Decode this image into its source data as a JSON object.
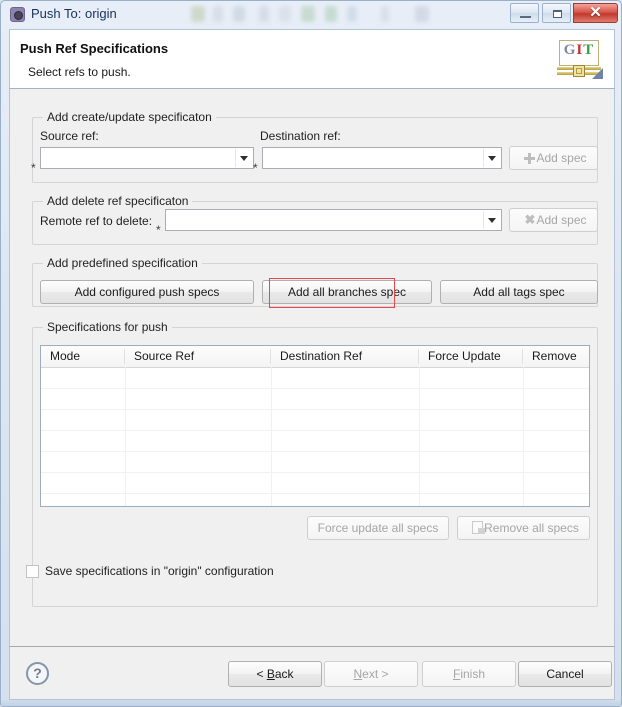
{
  "window": {
    "title": "Push To: origin",
    "icon": "push-repo-icon",
    "controls": {
      "minimize": "minimize-icon",
      "maximize": "maximize-icon",
      "close": "✕"
    }
  },
  "header": {
    "title": "Push Ref Specifications",
    "subtitle": "Select refs to push.",
    "logo": {
      "g": "G",
      "i": "I",
      "t": "T"
    }
  },
  "groups": {
    "create_update": {
      "label": "Add create/update specificaton",
      "source_ref_label": "Source ref:",
      "destination_ref_label": "Destination ref:",
      "source_ref_value": "",
      "destination_ref_value": "",
      "required_marker": "*",
      "add_spec_button": "Add spec"
    },
    "delete_ref": {
      "label": "Add delete ref specificaton",
      "remote_ref_label": "Remote ref to delete:",
      "remote_ref_value": "",
      "required_marker": "*",
      "add_spec_button": "Add spec"
    },
    "predefined": {
      "label": "Add predefined specification",
      "buttons": [
        "Add configured push specs",
        "Add all branches spec",
        "Add all tags spec"
      ]
    },
    "specs_for_push": {
      "label": "Specifications for push",
      "columns": [
        "Mode",
        "Source Ref",
        "Destination Ref",
        "Force Update",
        "Remove"
      ],
      "rows": [],
      "empty_row_count": 7,
      "force_update_all_button": "Force update all specs",
      "remove_all_button": "Remove all specs"
    }
  },
  "save_checkbox": {
    "label": "Save specifications in \"origin\" configuration",
    "checked": false
  },
  "footer": {
    "help": "?",
    "back": "< Back",
    "back_pre": "< ",
    "back_mnemonic": "B",
    "back_post": "ack",
    "next_pre": "",
    "next_mnemonic": "N",
    "next_post": "ext >",
    "finish_pre": "",
    "finish_mnemonic": "F",
    "finish_post": "inish",
    "cancel": "Cancel"
  },
  "highlight": {
    "color": "#e8474c",
    "target": "Add all branches spec"
  }
}
